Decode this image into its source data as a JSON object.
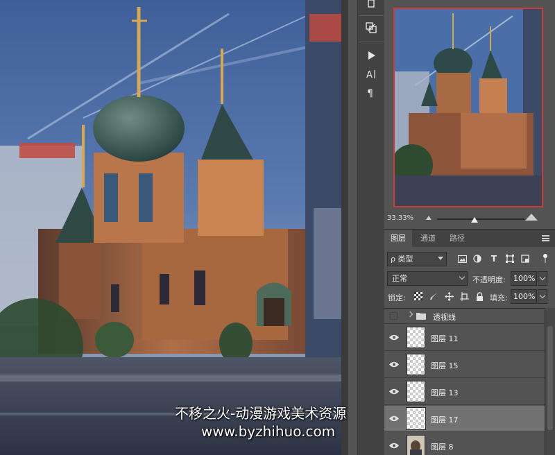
{
  "canvas": {
    "image": "onion-dome-cathedral-painting"
  },
  "tools": [
    {
      "name": "brush-preset-icon"
    },
    {
      "name": "clone-source-icon"
    },
    {
      "name": "play-icon"
    },
    {
      "name": "character-panel-icon"
    },
    {
      "name": "paragraph-icon"
    }
  ],
  "navigator": {
    "zoom": "33.33%"
  },
  "layers_panel": {
    "tabs": [
      {
        "label": "图层",
        "active": true
      },
      {
        "label": "通道",
        "active": false
      },
      {
        "label": "路径",
        "active": false
      }
    ],
    "filter": {
      "label": "ρ 类型"
    },
    "blend_mode": "正常",
    "opacity": {
      "label": "不透明度:",
      "value": "100%"
    },
    "lock": {
      "label": "锁定:"
    },
    "fill": {
      "label": "填充:",
      "value": "100%"
    },
    "group": {
      "name": "透视线"
    },
    "layers": [
      {
        "name": "图层 11",
        "selected": false
      },
      {
        "name": "图层 15",
        "selected": false
      },
      {
        "name": "图层 13",
        "selected": false
      },
      {
        "name": "图层 17",
        "selected": true
      },
      {
        "name": "图层 8",
        "selected": false
      }
    ]
  },
  "watermark": {
    "line1": "不移之火-动漫游戏美术资源",
    "line2": "www.byzhihuo.com"
  },
  "colors": {
    "panel": "#535353",
    "dark": "#424242",
    "selected": "#727272",
    "navigator_frame": "#d23a3a"
  }
}
